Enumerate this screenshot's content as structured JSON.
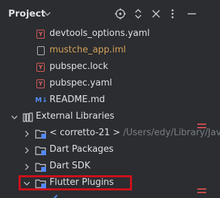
{
  "header": {
    "title": "Project",
    "icons": [
      "chevron-down-icon",
      "crosshair-icon",
      "expand-collapse-icon",
      "close-icon",
      "minimize-icon"
    ]
  },
  "tree": {
    "files": [
      {
        "name": "devtools_options.yaml",
        "icon": "yaml-file-icon"
      },
      {
        "name": "mustche_app.iml",
        "icon": "iml-file-icon"
      },
      {
        "name": "pubspec.lock",
        "icon": "yaml-file-icon"
      },
      {
        "name": "pubspec.yaml",
        "icon": "yaml-file-icon"
      },
      {
        "name": "README.md",
        "icon": "markdown-file-icon",
        "badge": "M↓"
      }
    ],
    "external_libraries": {
      "label": "External Libraries",
      "items": [
        {
          "name": "< corretto-21 >",
          "path": " /Users/edy/Library/Java"
        },
        {
          "name": "Dart Packages"
        },
        {
          "name": "Dart SDK"
        },
        {
          "name": "Flutter Plugins"
        }
      ]
    },
    "yaml_badge": "Y"
  },
  "colors": {
    "background": "#2b2d30",
    "text": "#dfe1e5",
    "muted_path": "#7a7e85",
    "iml_text": "#d6a05a",
    "highlight_border": "#d0101a"
  }
}
